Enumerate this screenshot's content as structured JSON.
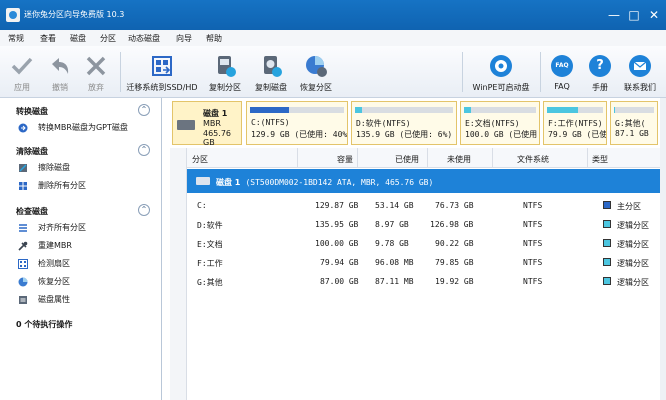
{
  "window": {
    "title": "迷你兔分区向导免费版 10.3"
  },
  "menu": [
    "常规",
    "查看",
    "磁盘",
    "分区",
    "动态磁盘",
    "向导",
    "帮助"
  ],
  "toolbar": {
    "apply": "应用",
    "undo": "撤销",
    "discard": "放弃",
    "migrate": "迁移系统到SSD/HD",
    "copy_partition": "复制分区",
    "copy_disk": "复制磁盘",
    "recover_partition": "恢复分区",
    "winpe": "WinPE可启动盘",
    "faq": "FAQ",
    "manual": "手册",
    "contact": "联系我们",
    "faq_badge": "FAQ"
  },
  "colors": {
    "titlebar": "#1673c4",
    "selected_row": "#1e82d8",
    "primary": "#2c68c6",
    "logical": "#4cc6e0"
  },
  "sidebar": {
    "sections": [
      {
        "title": "转换磁盘",
        "toggle": "⌃",
        "items": [
          {
            "label": "转换MBR磁盘为GPT磁盘",
            "icon": "convert-disk-icon"
          }
        ]
      },
      {
        "title": "清除磁盘",
        "toggle": "⌃",
        "items": [
          {
            "label": "擦除磁盘",
            "icon": "wipe-disk-icon"
          },
          {
            "label": "删除所有分区",
            "icon": "delete-partitions-icon"
          }
        ]
      },
      {
        "title": "检查磁盘",
        "toggle": "⌃",
        "items": [
          {
            "label": "对齐所有分区",
            "icon": "align-partitions-icon"
          },
          {
            "label": "重建MBR",
            "icon": "rebuild-mbr-icon"
          },
          {
            "label": "检测扇区",
            "icon": "surface-test-icon"
          },
          {
            "label": "恢复分区",
            "icon": "recover-partition-icon"
          },
          {
            "label": "磁盘属性",
            "icon": "disk-properties-icon"
          }
        ]
      }
    ],
    "pending": "0 个待执行操作"
  },
  "diskmap": {
    "disk": {
      "name": "磁盘 1",
      "type": "MBR",
      "size": "465.76 GB"
    },
    "partitions": [
      {
        "line1": "C:(NTFS)",
        "line2": "129.9 GB (已使用: 40%)",
        "used_fraction": 0.41,
        "kind": "primary"
      },
      {
        "line1": "D:软件(NTFS)",
        "line2": "135.9 GB (已使用: 6%)",
        "used_fraction": 0.07,
        "kind": "logical"
      },
      {
        "line1": "E:文档(NTFS)",
        "line2": "100.0 GB (已使用:",
        "used_fraction": 0.1,
        "kind": "logical"
      },
      {
        "line1": "F:工作(NTFS)",
        "line2": "79.9 GB (已使用:",
        "used_fraction": 0.55,
        "kind": "logical"
      },
      {
        "line1": "G:其他(",
        "line2": "87.1 GB",
        "used_fraction": 0.03,
        "kind": "logical"
      }
    ]
  },
  "table": {
    "headers": [
      "分区",
      "容量",
      "已使用",
      "未使用",
      "文件系统",
      "类型"
    ],
    "disk_row": {
      "name": "磁盘 1",
      "detail": "(ST500DM002-1BD142 ATA, MBR, 465.76 GB)"
    },
    "rows": [
      {
        "partition": "C:",
        "capacity": "129.87 GB",
        "used": "53.14 GB",
        "unused": "76.73 GB",
        "fs": "NTFS",
        "type": "主分区",
        "kind": "primary"
      },
      {
        "partition": "D:软件",
        "capacity": "135.95 GB",
        "used": "8.97 GB",
        "unused": "126.98 GB",
        "fs": "NTFS",
        "type": "逻辑分区",
        "kind": "logical"
      },
      {
        "partition": "E:文档",
        "capacity": "100.00 GB",
        "used": "9.78 GB",
        "unused": "90.22 GB",
        "fs": "NTFS",
        "type": "逻辑分区",
        "kind": "logical"
      },
      {
        "partition": "F:工作",
        "capacity": "79.94 GB",
        "used": "96.08 MB",
        "unused": "79.85 GB",
        "fs": "NTFS",
        "type": "逻辑分区",
        "kind": "logical"
      },
      {
        "partition": "G:其他",
        "capacity": "87.00 GB",
        "used": "87.11 MB",
        "unused": "19.92 GB",
        "fs": "NTFS",
        "type": "逻辑分区",
        "kind": "logical"
      }
    ]
  }
}
